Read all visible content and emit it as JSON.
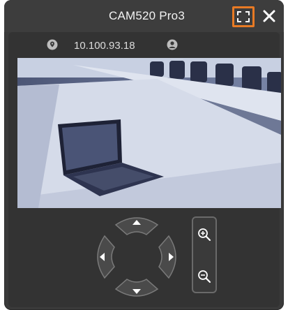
{
  "window": {
    "title": "CAM520 Pro3",
    "accent_color": "#e87a24"
  },
  "toolbar": {
    "fullscreen_icon": "fullscreen-icon",
    "close_icon": "close-icon"
  },
  "info": {
    "location_icon": "location-pin-icon",
    "ip_address": "10.100.93.18",
    "user_icon": "user-icon"
  },
  "controls": {
    "pan_tilt": [
      "up",
      "down",
      "left",
      "right"
    ],
    "zoom": [
      "zoom-in",
      "zoom-out"
    ]
  }
}
